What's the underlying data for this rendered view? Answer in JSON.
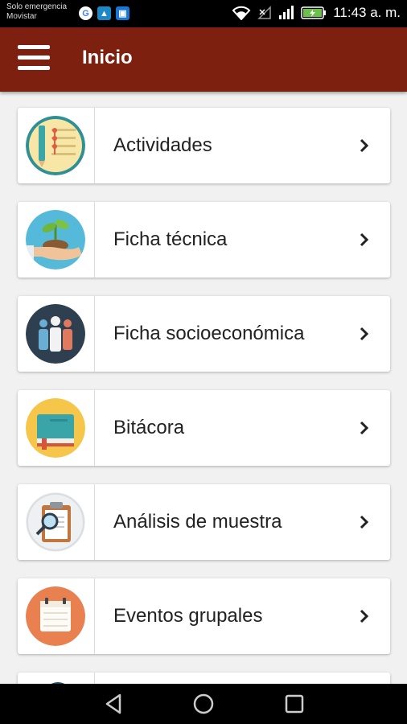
{
  "status_bar": {
    "carrier_line1": "Solo emergencia",
    "carrier_line2": "Movistar",
    "time": "11:43 a. m."
  },
  "app_bar": {
    "title": "Inicio"
  },
  "menu_items": [
    {
      "label": "Actividades",
      "icon": "activities-icon"
    },
    {
      "label": "Ficha técnica",
      "icon": "plant-in-hand-icon"
    },
    {
      "label": "Ficha socioeconómica",
      "icon": "people-icon"
    },
    {
      "label": "Bitácora",
      "icon": "book-icon"
    },
    {
      "label": "Análisis de muestra",
      "icon": "clipboard-magnifier-icon"
    },
    {
      "label": "Eventos grupales",
      "icon": "calendar-icon"
    }
  ],
  "colors": {
    "app_bar": "#7e2010",
    "background": "#f1f1f1"
  }
}
